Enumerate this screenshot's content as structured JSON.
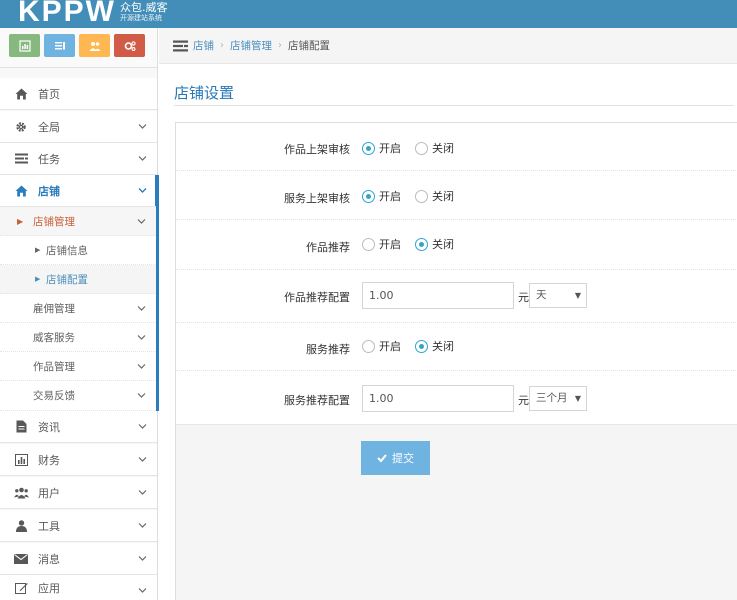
{
  "brand": {
    "logo": "KPPW",
    "name": "众包.威客",
    "tagline": "开源建站系统"
  },
  "shortcuts": [
    {
      "icon": "chart-icon",
      "color": "#87b87f"
    },
    {
      "icon": "pencil-icon",
      "color": "#6fb3e0"
    },
    {
      "icon": "users-icon",
      "color": "#ffb752"
    },
    {
      "icon": "cogs-icon",
      "color": "#d15b47"
    }
  ],
  "nav": {
    "home": "首页",
    "global": "全局",
    "tasks": "任务",
    "shop": "店铺",
    "shop_manage": "店铺管理",
    "shop_info": "店铺信息",
    "shop_config": "店铺配置",
    "hire_manage": "雇佣管理",
    "witkey_service": "威客服务",
    "works_manage": "作品管理",
    "trade_feedback": "交易反馈",
    "news": "资讯",
    "finance": "财务",
    "users": "用户",
    "tools": "工具",
    "messages": "消息",
    "apps": "应用"
  },
  "breadcrumb": {
    "items": [
      "店铺",
      "店铺管理",
      "店铺配置"
    ]
  },
  "page": {
    "title": "店铺设置"
  },
  "form": {
    "works_review": {
      "label": "作品上架审核",
      "on": "开启",
      "off": "关闭",
      "selected": "on"
    },
    "service_review": {
      "label": "服务上架审核",
      "on": "开启",
      "off": "关闭",
      "selected": "on"
    },
    "works_recommend": {
      "label": "作品推荐",
      "on": "开启",
      "off": "关闭",
      "selected": "off"
    },
    "works_recommend_config": {
      "label": "作品推荐配置",
      "value": "1.00",
      "unit": "元",
      "period": "天"
    },
    "service_recommend": {
      "label": "服务推荐",
      "on": "开启",
      "off": "关闭",
      "selected": "off"
    },
    "service_recommend_config": {
      "label": "服务推荐配置",
      "value": "1.00",
      "unit": "元",
      "period": "三个月"
    },
    "submit": "提交"
  }
}
